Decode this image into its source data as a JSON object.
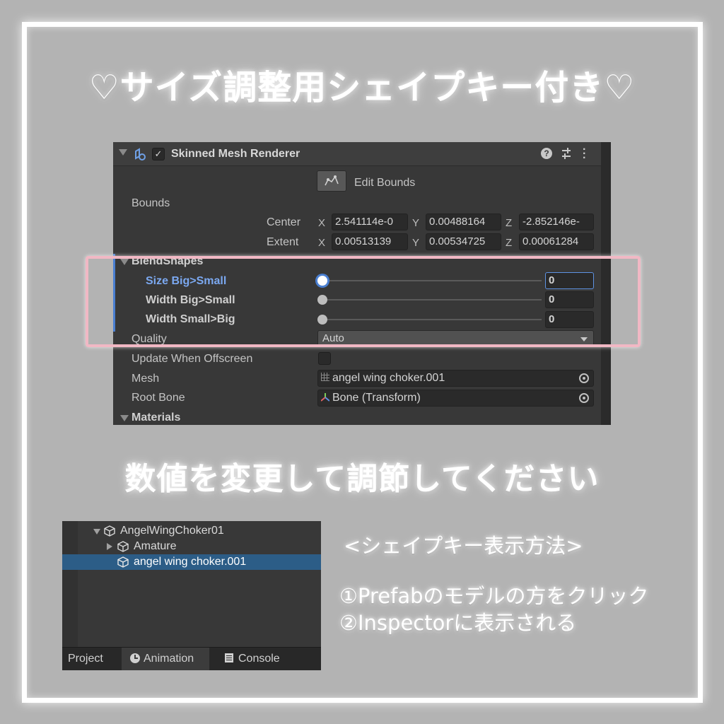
{
  "title": "♡サイズ調整用シェイプキー付き♡",
  "subtitle": "数値を変更して調節してください",
  "howto": {
    "heading": "<シェイプキー表示方法>",
    "step1": "①Prefabのモデルの方をクリック",
    "step2": "②Inspectorに表示される"
  },
  "inspector": {
    "component_title": "Skinned Mesh Renderer",
    "edit_bounds_label": "Edit Bounds",
    "bounds_label": "Bounds",
    "center_label": "Center",
    "extent_label": "Extent",
    "axis_x": "X",
    "axis_y": "Y",
    "axis_z": "Z",
    "center": {
      "x": "2.541114e-0",
      "y": "0.00488164",
      "z": "-2.852146e-"
    },
    "extent": {
      "x": "0.00513139",
      "y": "0.00534725",
      "z": "0.00061284"
    },
    "blendshapes_label": "BlendShapes",
    "blendshapes": [
      {
        "name": "Size Big>Small",
        "value": "0"
      },
      {
        "name": "Width Big>Small",
        "value": "0"
      },
      {
        "name": "Width Small>Big",
        "value": "0"
      }
    ],
    "quality_label": "Quality",
    "quality_value": "Auto",
    "update_offscreen_label": "Update When Offscreen",
    "mesh_label": "Mesh",
    "mesh_value": "angel wing choker.001",
    "root_bone_label": "Root Bone",
    "root_bone_value": "Bone (Transform)",
    "materials_label": "Materials"
  },
  "hierarchy": {
    "root": "AngelWingChoker01",
    "child1": "Amature",
    "child2": "angel wing choker.001",
    "tabs": [
      "Project",
      "Animation",
      "Console"
    ]
  },
  "colors": {
    "highlight": "#f1b8c4",
    "selection": "#2c5d87",
    "accent": "#4a7fd1"
  }
}
